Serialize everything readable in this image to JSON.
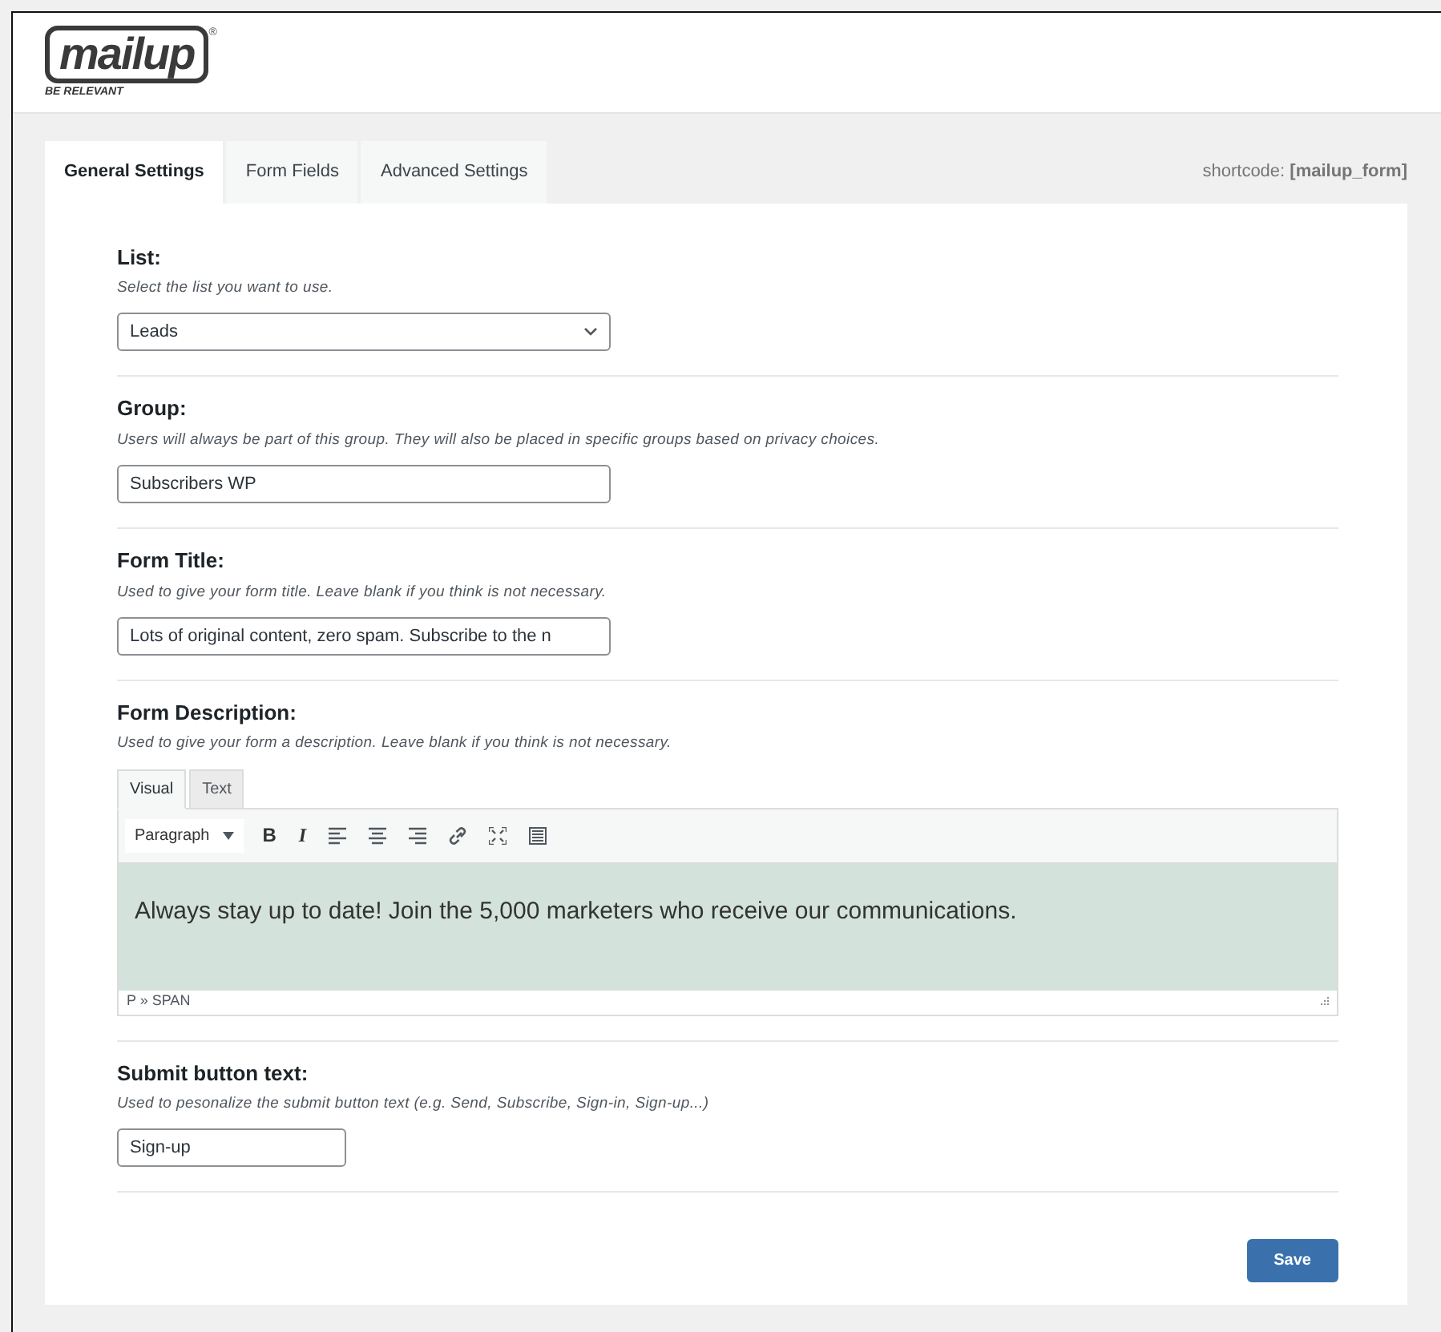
{
  "logo": {
    "wordmark": "mailup",
    "registered": "®",
    "tagline": "BE RELEVANT"
  },
  "tabs": [
    {
      "label": "General Settings",
      "selected": true
    },
    {
      "label": "Form Fields",
      "selected": false
    },
    {
      "label": "Advanced Settings",
      "selected": false
    }
  ],
  "shortcode": "shortcode: **[mailup_form]**",
  "sections": [
    {
      "kind": "select",
      "label": "List:",
      "description": "Select the list you want to use.",
      "value": "Leads"
    },
    {
      "kind": "input",
      "label": "Group:",
      "description": "Users will always be part of this group. They will also be placed in specific groups based on privacy choices.",
      "value": "Subscribers WP"
    },
    {
      "kind": "input",
      "label": "Form Title:",
      "description": "Used to give your form title. Leave blank if you think is not necessary.",
      "value": "Lots of original content, zero spam. Subscribe to the n"
    },
    {
      "kind": "editor",
      "label": "Form Description:",
      "description": "Used to give your form a description. Leave blank if you think is not necessary.",
      "editor_tabs": [
        {
          "label": "Visual",
          "selected": true
        },
        {
          "label": "Text",
          "selected": false
        }
      ],
      "format": "Paragraph",
      "format_buttons": [
        "B",
        "I"
      ],
      "content": "Always stay up to date! Join the 5,000 marketers who receive our communications.",
      "path": "P » SPAN"
    },
    {
      "kind": "input_short",
      "label": "Submit button text:",
      "description": "Used to pesonalize the submit button text (e.g. Send, Subscribe, Sign-in, Sign-up...)",
      "value": "Sign-up"
    }
  ],
  "save_button": "Save"
}
